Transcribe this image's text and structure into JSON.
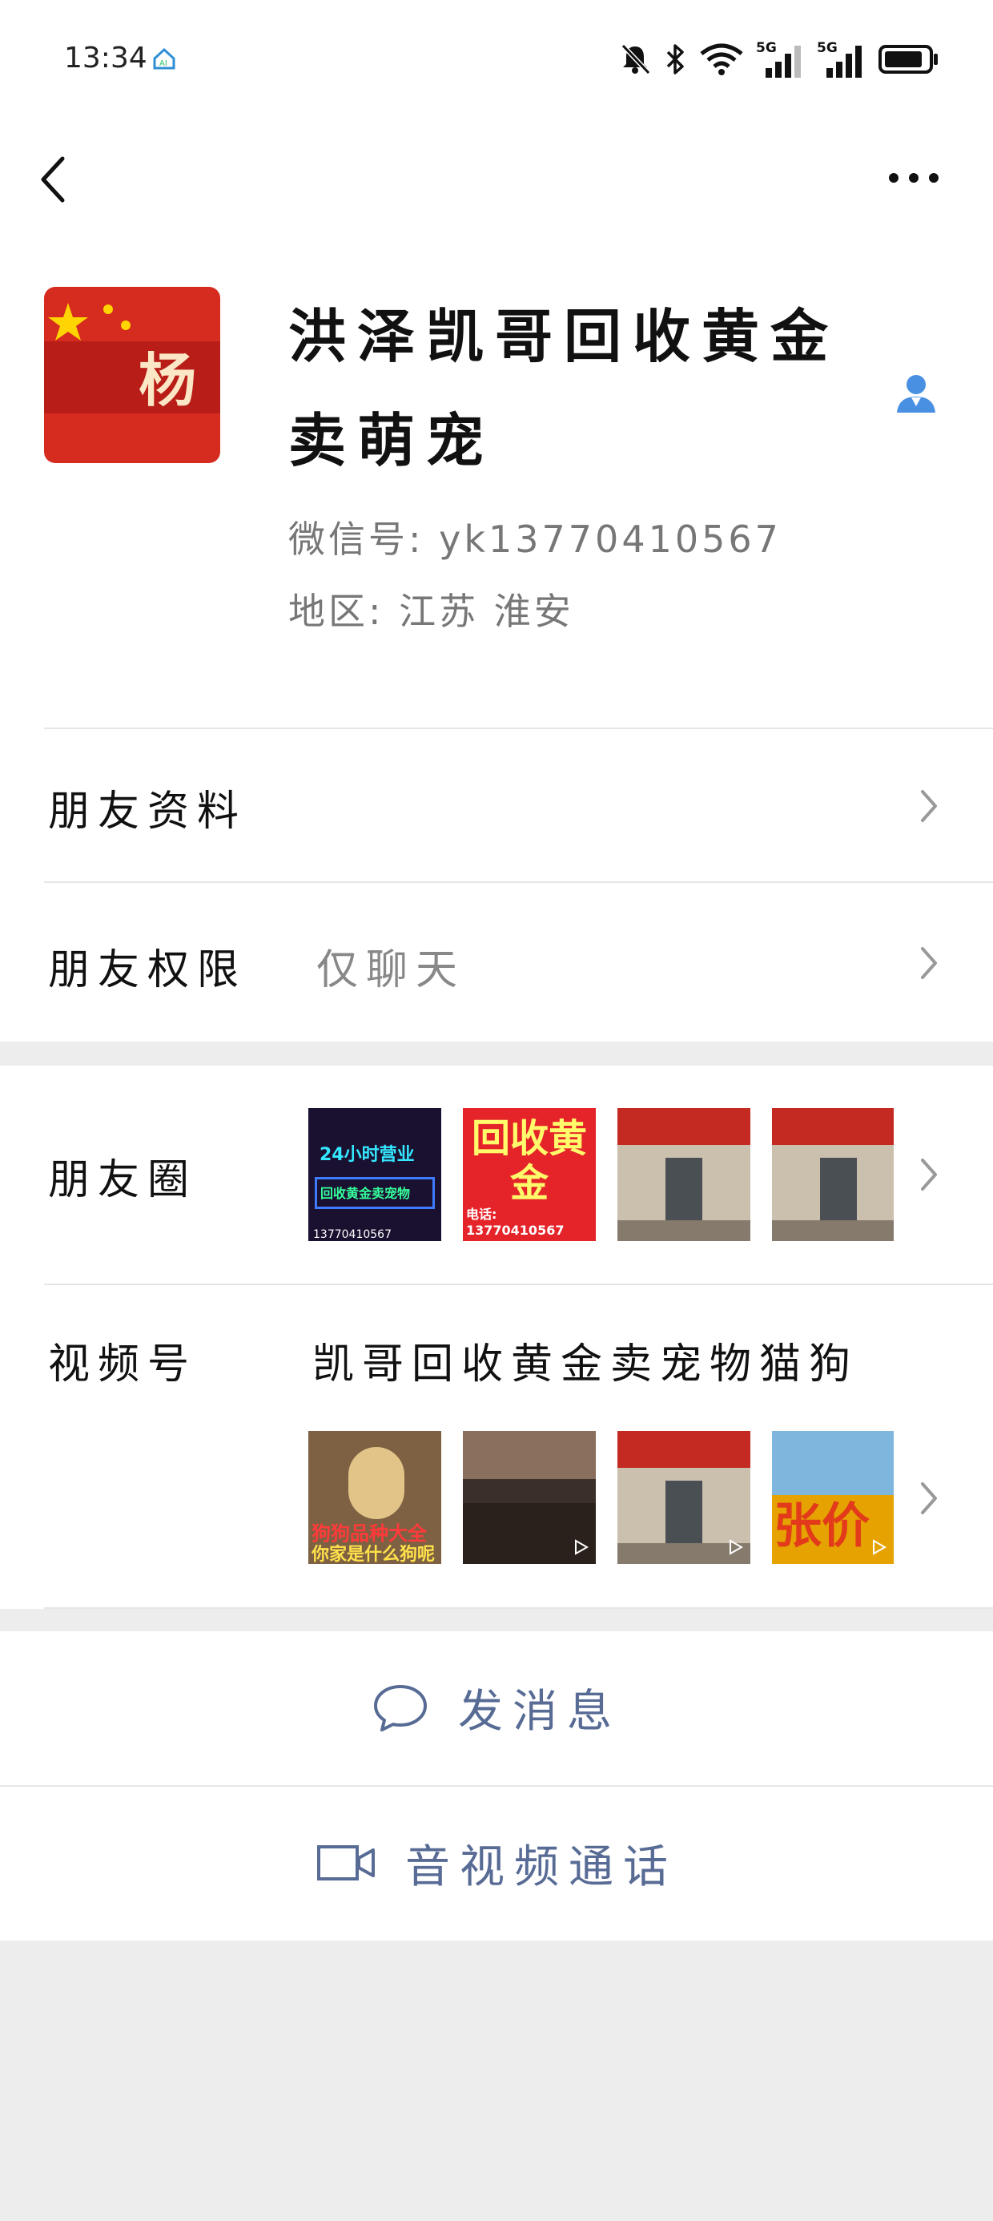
{
  "status_bar": {
    "time": "13:34",
    "icons": [
      "home-ai-icon",
      "mute-bell-icon",
      "bluetooth-icon",
      "wifi-icon",
      "signal-5g-icon",
      "signal-5g-icon",
      "battery-icon"
    ],
    "network_labels": [
      "5G",
      "5G"
    ]
  },
  "nav": {
    "back_icon": "chevron-left-icon",
    "more_icon": "more-dots-icon"
  },
  "profile": {
    "avatar_char": "杨",
    "name": "洪泽凯哥回收黄金卖萌宠",
    "wechat_id": "微信号: yk13770410567",
    "region": "地区: 江苏 淮安",
    "contact_icon": "contact-person-icon"
  },
  "rows": {
    "friend_info": {
      "label": "朋友资料"
    },
    "friend_permission": {
      "label": "朋友权限",
      "value": "仅聊天"
    },
    "moments": {
      "label": "朋友圈",
      "thumbs": [
        {
          "line1": "24小时营业",
          "line2": "回收黄金卖宠物",
          "foot": "13770410567"
        },
        {
          "line1": "回收黄金",
          "foot": "电话: 13770410567"
        },
        {
          "line1": ""
        },
        {
          "line1": ""
        }
      ]
    },
    "channels": {
      "label": "视频号",
      "channel_name": "凯哥回收黄金卖宠物猫狗",
      "thumbs": [
        {
          "line1": "狗狗品种大全",
          "line2": "你家是什么狗呢"
        },
        {
          "line1": ""
        },
        {
          "line1": ""
        },
        {
          "line1": "张价"
        }
      ]
    }
  },
  "actions": {
    "send_message": "发消息",
    "av_call": "音视频通话"
  },
  "colors": {
    "link_blue": "#576b95",
    "background_gray": "#ededed",
    "avatar_red": "#d62b1f"
  }
}
